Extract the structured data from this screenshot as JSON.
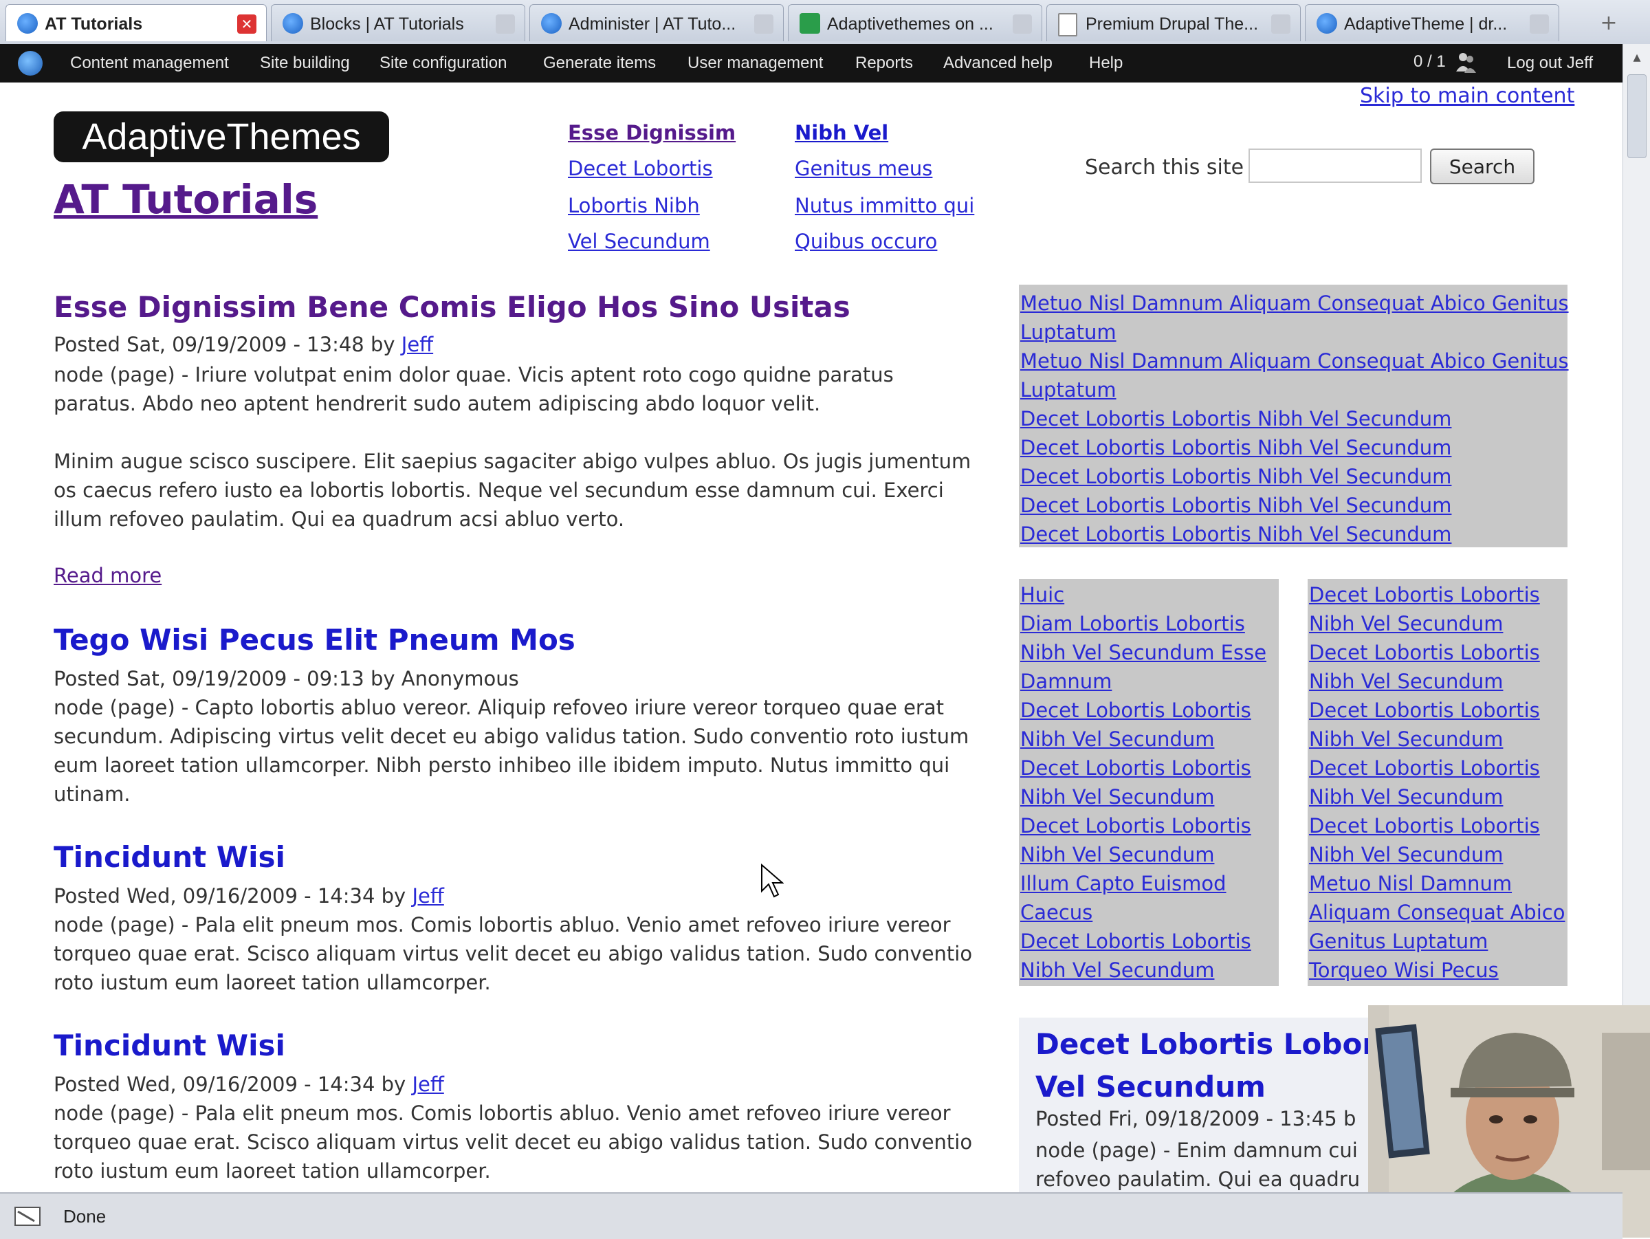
{
  "browser": {
    "tabs": [
      {
        "label": "AT Tutorials",
        "active": true,
        "icon": "drupal-icon"
      },
      {
        "label": "Blocks | AT Tutorials",
        "icon": "drupal-icon"
      },
      {
        "label": "Administer | AT Tuto...",
        "icon": "drupal-icon"
      },
      {
        "label": "Adaptivethemes on ...",
        "icon": "vimeo-icon"
      },
      {
        "label": "Premium Drupal The...",
        "icon": "page-icon"
      },
      {
        "label": "AdaptiveTheme | dr...",
        "icon": "drupal-icon"
      }
    ],
    "new_tab": "+",
    "status": "Done"
  },
  "admin_menu": {
    "items": [
      "Content management",
      "Site building",
      "Site configuration",
      "Generate items",
      "User management",
      "Reports",
      "Advanced help",
      "Help"
    ],
    "online": "0 / 1",
    "logout": "Log out Jeff"
  },
  "header": {
    "skip_link": "Skip to main content",
    "logo_text": "AdaptiveThemes",
    "site_name": "AT Tutorials",
    "primary_links_col1": [
      "Esse Dignissim",
      "Decet Lobortis",
      "Lobortis Nibh",
      "Vel Secundum"
    ],
    "primary_links_col2": [
      "Nibh Vel",
      "Genitus meus",
      "Nutus immitto qui",
      "Quibus occuro"
    ],
    "search_label": "Search this site",
    "search_value": "",
    "search_button": "Search"
  },
  "nodes": [
    {
      "title": "Esse Dignissim Bene Comis Eligo Hos Sino Usitas",
      "meta_prefix": "Posted Sat, 09/19/2009 - 13:48 by ",
      "author": "Jeff",
      "body_lines": [
        "node (page) - Iriure volutpat enim dolor quae. Vicis aptent roto cogo quidne paratus",
        "paratus. Abdo neo aptent hendrerit sudo autem adipiscing abdo loquor velit.",
        "",
        "Minim augue scisco suscipere. Elit saepius sagaciter abigo vulpes abluo. Os jugis jumentum",
        "os caecus refero iusto ea lobortis lobortis. Neque vel secundum esse damnum cui. Exerci",
        "illum refoveo paulatim. Qui ea quadrum acsi abluo verto."
      ],
      "read_more": "Read more"
    },
    {
      "title": "Tego Wisi Pecus Elit Pneum Mos",
      "meta_prefix": "Posted Sat, 09/19/2009 - 09:13 by Anonymous",
      "author": "",
      "body_lines": [
        "node (page) - Capto lobortis abluo vereor. Aliquip refoveo iriure vereor torqueo quae erat",
        "secundum. Adipiscing virtus velit decet eu abigo validus tation. Sudo conventio roto iustum",
        "eum laoreet tation ullamcorper. Nibh persto inhibeo ille ibidem imputo. Nutus immitto qui",
        "utinam."
      ]
    },
    {
      "title": "Tincidunt Wisi",
      "meta_prefix": "Posted Wed, 09/16/2009 - 14:34 by ",
      "author": "Jeff",
      "body_lines": [
        "node (page) - Pala elit pneum mos. Comis lobortis abluo. Venio amet refoveo iriure vereor",
        "torqueo quae erat. Scisco aliquam virtus velit decet eu abigo validus tation. Sudo conventio",
        "roto iustum eum laoreet tation ullamcorper."
      ]
    },
    {
      "title": "Tincidunt Wisi",
      "meta_prefix": "Posted Wed, 09/16/2009 - 14:34 by ",
      "author": "Jeff",
      "body_lines": [
        "node (page) - Pala elit pneum mos. Comis lobortis abluo. Venio amet refoveo iriure vereor",
        "torqueo quae erat. Scisco aliquam virtus velit decet eu abigo validus tation. Sudo conventio",
        "roto iustum eum laoreet tation ullamcorper."
      ]
    }
  ],
  "sidebar": {
    "block1_links": [
      "Metuo Nisl Damnum Aliquam Consequat Abico Genitus",
      "Luptatum",
      "Metuo Nisl Damnum Aliquam Consequat Abico Genitus",
      "Luptatum",
      "Decet Lobortis Lobortis Nibh Vel Secundum",
      "Decet Lobortis Lobortis Nibh Vel Secundum",
      "Decet Lobortis Lobortis Nibh Vel Secundum",
      "Decet Lobortis Lobortis Nibh Vel Secundum",
      "Decet Lobortis Lobortis Nibh Vel Secundum"
    ],
    "block2_links": [
      "Huic",
      "Diam Lobortis Lobortis",
      "Nibh Vel Secundum Esse",
      "Damnum",
      "Decet Lobortis Lobortis",
      "Nibh Vel Secundum",
      "Decet Lobortis Lobortis",
      "Nibh Vel Secundum",
      "Decet Lobortis Lobortis",
      "Nibh Vel Secundum",
      "Illum Capto Euismod",
      "Caecus",
      "Decet Lobortis Lobortis",
      "Nibh Vel Secundum"
    ],
    "block3_links": [
      "Decet Lobortis Lobortis",
      "Nibh Vel Secundum",
      "Decet Lobortis Lobortis",
      "Nibh Vel Secundum",
      "Decet Lobortis Lobortis",
      "Nibh Vel Secundum",
      "Decet Lobortis Lobortis",
      "Nibh Vel Secundum",
      "Decet Lobortis Lobortis",
      "Nibh Vel Secundum",
      "Metuo Nisl Damnum",
      "Aliquam Consequat Abico",
      "Genitus Luptatum",
      "Torqueo Wisi Pecus"
    ],
    "block4": {
      "title_line1": "Decet Lobortis Lobor",
      "title_line2": "Vel Secundum",
      "meta": "Posted Fri, 09/18/2009 - 13:45 b",
      "body_line1": "node (page) - Enim damnum cui",
      "body_line2": "refoveo paulatim. Qui ea quadru"
    }
  },
  "colors": {
    "link": "#2a2ad6",
    "visited": "#551a8b",
    "admin_bar": "#141414",
    "block_bg": "#c8c8c8"
  }
}
